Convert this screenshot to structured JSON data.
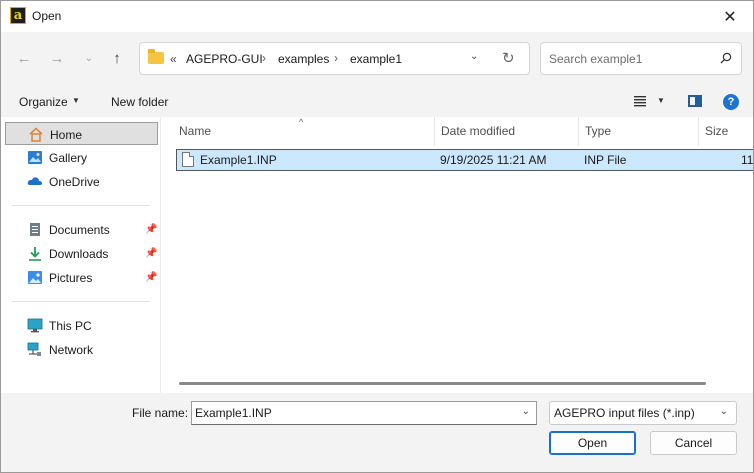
{
  "window": {
    "title": "Open",
    "app_icon_glyph": "a",
    "close_glyph": "✕"
  },
  "nav": {
    "back_glyph": "←",
    "forward_glyph": "→",
    "recent_glyph": "⌄",
    "up_glyph": "↑",
    "breadcrumb_overflow": "«",
    "breadcrumb": [
      "AGEPRO-GUI",
      "examples",
      "example1"
    ],
    "separator": "›",
    "dropdown_glyph": "⌄",
    "refresh_glyph": "↻"
  },
  "search": {
    "placeholder": "Search example1"
  },
  "toolbar": {
    "organize_label": "Organize",
    "organize_caret": "▼",
    "new_folder_label": "New folder",
    "view_caret": "▼",
    "help_label": "?"
  },
  "sidebar": {
    "items": [
      {
        "label": "Home",
        "icon": "home-icon",
        "selected": true
      },
      {
        "label": "Gallery",
        "icon": "gallery-icon"
      },
      {
        "label": "OneDrive",
        "icon": "cloud-icon"
      },
      {
        "label": "Documents",
        "icon": "documents-icon",
        "pinned": true
      },
      {
        "label": "Downloads",
        "icon": "download-icon",
        "pinned": true
      },
      {
        "label": "Pictures",
        "icon": "pictures-icon",
        "pinned": true
      },
      {
        "label": "This PC",
        "icon": "pc-icon"
      },
      {
        "label": "Network",
        "icon": "network-icon"
      }
    ],
    "pin_glyph": "📌"
  },
  "file_list": {
    "columns": [
      "Name",
      "Date modified",
      "Type",
      "Size"
    ],
    "sort_glyph": "^",
    "rows": [
      {
        "name": "Example1.INP",
        "date_modified": "9/19/2025 11:21 AM",
        "type": "INP File",
        "size": "11"
      }
    ]
  },
  "bottom": {
    "file_name_label": "File name:",
    "file_name_value": "Example1.INP",
    "file_name_caret": "⌄",
    "filter_value": "AGEPRO input files (*.inp)",
    "filter_caret": "⌄",
    "open_label": "Open",
    "cancel_label": "Cancel"
  },
  "colors": {
    "selection": "#cce8ff",
    "accent": "#1c6fc9",
    "folder": "#f4c542"
  }
}
